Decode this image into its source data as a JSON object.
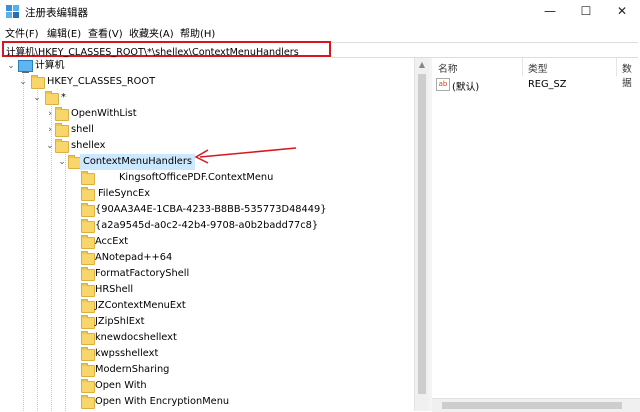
{
  "window": {
    "title": "注册表编辑器",
    "buttons": {
      "minimize": "—",
      "maximize": "☐",
      "close": "✕"
    }
  },
  "menu": [
    "文件(F)",
    "编辑(E)",
    "查看(V)",
    "收藏夹(A)",
    "帮助(H)"
  ],
  "address": "计算机\\HKEY_CLASSES_ROOT\\*\\shellex\\ContextMenuHandlers",
  "tree": {
    "root": "计算机",
    "hive": "HKEY_CLASSES_ROOT",
    "star": "*",
    "items": [
      "OpenWithList",
      "shell",
      "shellex"
    ],
    "selected": "ContextMenuHandlers",
    "children": [
      "KingsoftOfficePDF.ContextMenu",
      "FileSyncEx",
      "{90AA3A4E-1CBA-4233-B8BB-535773D48449}",
      "{a2a9545d-a0c2-42b4-9708-a0b2badd77c8}",
      "AccExt",
      "ANotepad++64",
      "FormatFactoryShell",
      "HRShell",
      "JZContextMenuExt",
      "JZipShlExt",
      "knewdocshellext",
      "kwpsshellext",
      "ModernSharing",
      "Open With",
      "Open With EncryptionMenu"
    ]
  },
  "values_pane": {
    "columns": [
      "名称",
      "类型",
      "数据"
    ],
    "rows": [
      {
        "name": "(默认)",
        "type": "REG_SZ",
        "icon": "ab-icon"
      }
    ]
  },
  "colors": {
    "highlight": "#d8161f",
    "selection": "#cce8ff"
  }
}
